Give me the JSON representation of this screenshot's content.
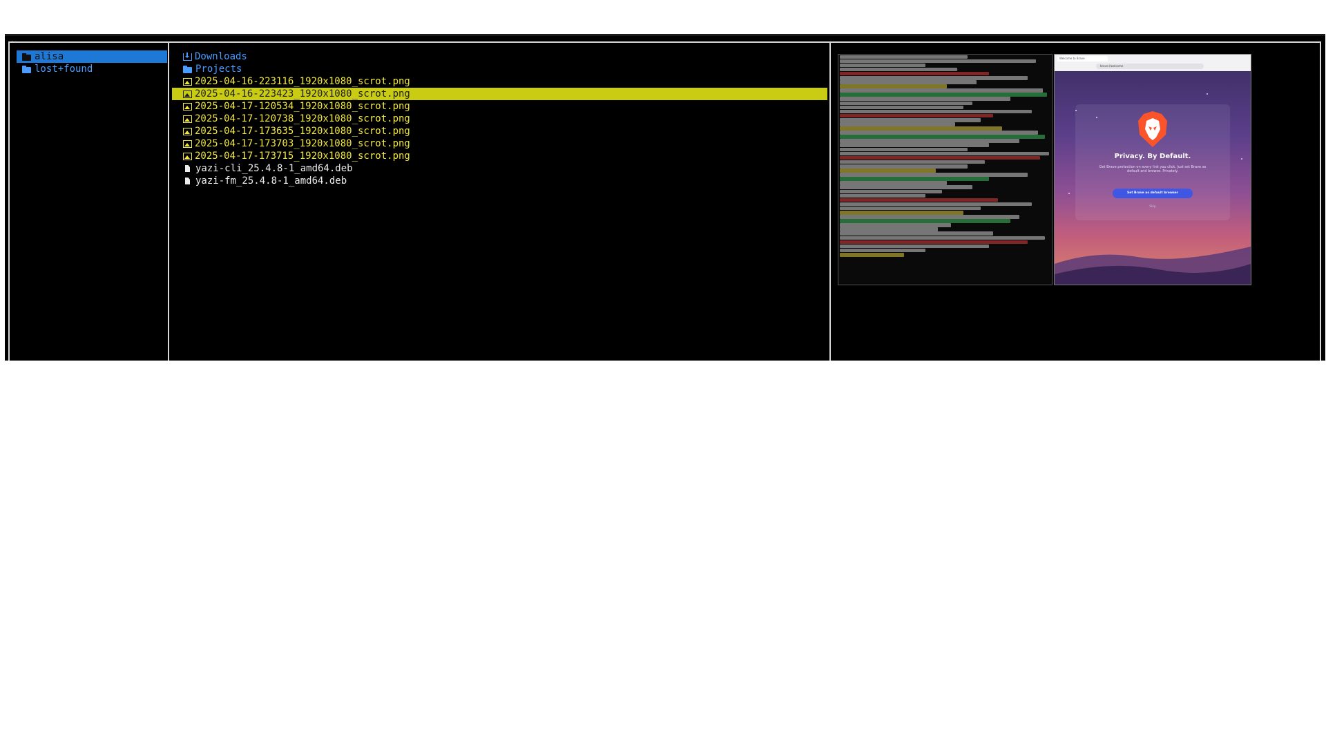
{
  "header": {
    "path": "~"
  },
  "parent_pane": {
    "items": [
      {
        "name": "alisa",
        "kind": "folder",
        "selected": true
      },
      {
        "name": "lost+found",
        "kind": "folder",
        "selected": false
      }
    ]
  },
  "current_pane": {
    "items": [
      {
        "name": "Downloads",
        "kind": "downloads-folder"
      },
      {
        "name": "Projects",
        "kind": "folder"
      },
      {
        "name": "2025-04-16-223116_1920x1080_scrot.png",
        "kind": "image"
      },
      {
        "name": "2025-04-16-223423_1920x1080_scrot.png",
        "kind": "image",
        "selected": true
      },
      {
        "name": "2025-04-17-120534_1920x1080_scrot.png",
        "kind": "image"
      },
      {
        "name": "2025-04-17-120738_1920x1080_scrot.png",
        "kind": "image"
      },
      {
        "name": "2025-04-17-173635_1920x1080_scrot.png",
        "kind": "image"
      },
      {
        "name": "2025-04-17-173703_1920x1080_scrot.png",
        "kind": "image"
      },
      {
        "name": "2025-04-17-173715_1920x1080_scrot.png",
        "kind": "image"
      },
      {
        "name": "yazi-cli_25.4.8-1_amd64.deb",
        "kind": "file"
      },
      {
        "name": "yazi-fm_25.4.8-1_amd64.deb",
        "kind": "file"
      }
    ]
  },
  "preview": {
    "browser": {
      "tab_title": "Welcome to Brave",
      "url": "brave://welcome",
      "headline": "Privacy. By Default.",
      "subtitle": "Get Brave protection on every link you click. Just set Brave as default and browse. Privately.",
      "button_label": "Set Brave as default browser",
      "skip_label": "Skip"
    }
  },
  "colors": {
    "directory": "#4a9cff",
    "image_file": "#f0e642",
    "plain_file": "#ececec",
    "parent_selection": "#1e78d6",
    "current_selection": "#c9cc12",
    "frame": "#d8d8d8",
    "background": "#000000"
  }
}
